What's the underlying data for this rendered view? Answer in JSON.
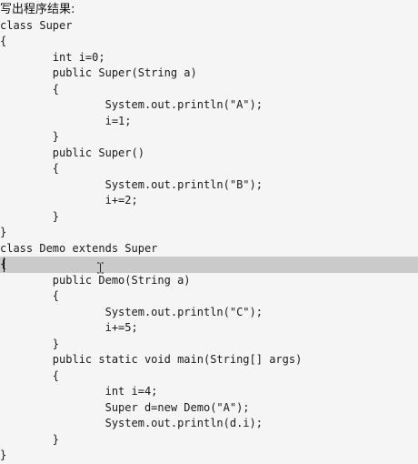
{
  "editor": {
    "lines": [
      "写出程序结果:",
      "class Super",
      "{",
      "        int i=0;",
      "        public Super(String a)",
      "        {",
      "                System.out.println(\"A\");",
      "                i=1;",
      "        }",
      "        public Super()",
      "        {",
      "                System.out.println(\"B\");",
      "                i+=2;",
      "        }",
      "}",
      "class Demo extends Super",
      "{",
      "        public Demo(String a)",
      "        {",
      "                System.out.println(\"C\");",
      "                i+=5;",
      "        }",
      "        public static void main(String[] args)",
      "        {",
      "                int i=4;",
      "                Super d=new Demo(\"A\");",
      "                System.out.println(d.i);",
      "        }",
      "}"
    ],
    "current_line": 16,
    "cursor_icon": "ibeam-icon",
    "highlight_color": "#c9cac9",
    "background_color": "#f4f5f4"
  }
}
